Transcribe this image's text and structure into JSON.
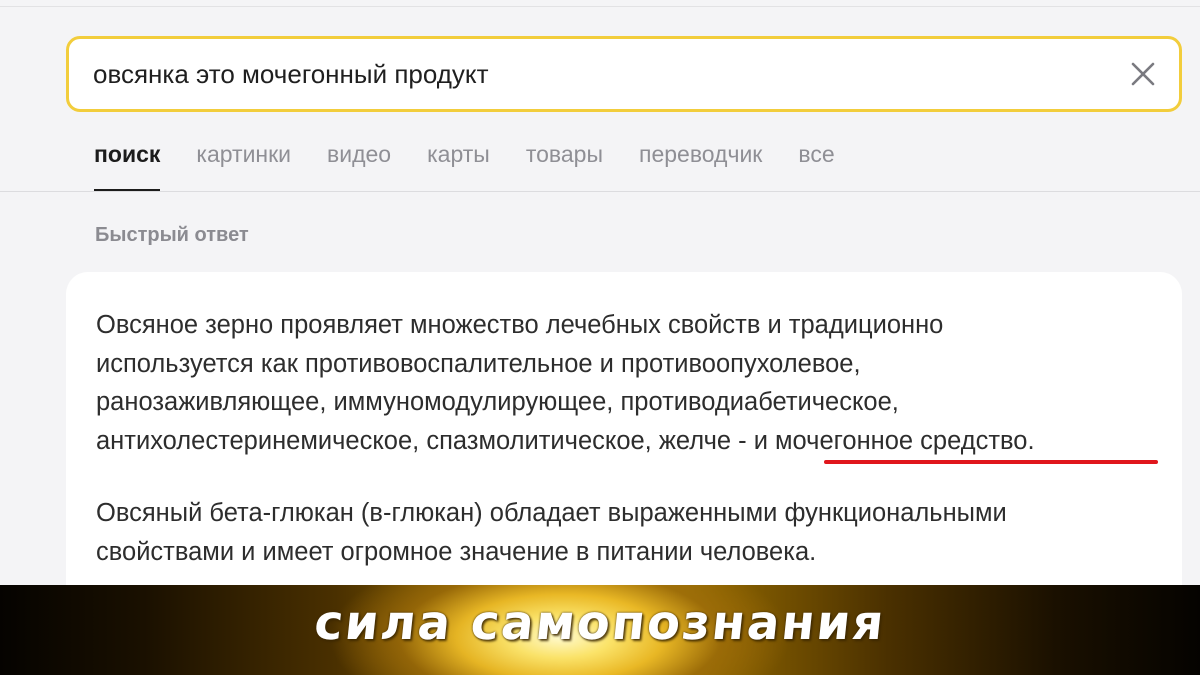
{
  "search": {
    "query": "овсянка это мочегонный продукт",
    "clear_icon": "close-icon"
  },
  "tabs": [
    {
      "label": "поиск",
      "active": true
    },
    {
      "label": "картинки",
      "active": false
    },
    {
      "label": "видео",
      "active": false
    },
    {
      "label": "карты",
      "active": false
    },
    {
      "label": "товары",
      "active": false
    },
    {
      "label": "переводчик",
      "active": false
    },
    {
      "label": "все",
      "active": false
    }
  ],
  "quick_answer": {
    "title": "Быстрый ответ",
    "paragraph1": "Овсяное зерно проявляет множество лечебных свойств и традиционно\nиспользуется как противовоспалительное и противоопухолевое,\nранозаживляющее, иммуномодулирующее, противодиабетическое,\nантихолестеринемическое, спазмолитическое, желче - и мочегонное средство.",
    "paragraph2": "Овсяный бета-глюкан (в-глюкан) обладает выраженными функциональными\nсвойствами и имеет огромное значение в питании человека."
  },
  "banner": {
    "text": "сила самопознания"
  },
  "colors": {
    "search_border": "#f2cd3c",
    "highlight_underline": "#e0161c",
    "background": "#f4f4f6"
  }
}
